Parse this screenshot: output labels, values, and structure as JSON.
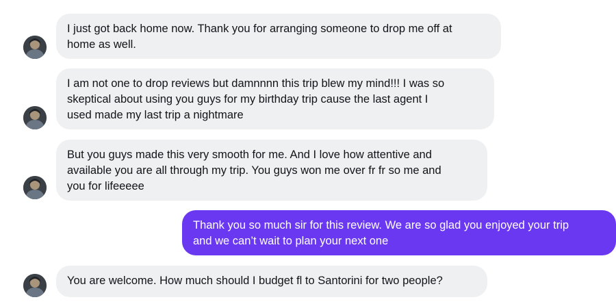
{
  "messages": [
    {
      "direction": "incoming",
      "lines": [
        "I just got back home now. Thank you for arranging someone to drop me off at",
        "home as well."
      ]
    },
    {
      "direction": "incoming",
      "lines": [
        "I am not one to drop reviews but damnnnn this trip blew my mind!!! I was so",
        "skeptical about using you guys for my birthday trip cause the last agent I",
        "used made my last trip a nightmare"
      ]
    },
    {
      "direction": "incoming",
      "lines": [
        "But you guys made this very smooth for me. And I love how attentive and",
        "available you are all through my trip. You guys won me over fr fr so me and",
        "you for lifeeeee"
      ]
    },
    {
      "direction": "outgoing",
      "lines": [
        "Thank you so much sir for this review. We are so glad you enjoyed your trip",
        "and we can’t wait to plan your next one"
      ]
    },
    {
      "direction": "incoming",
      "lines": [
        "You are welcome. How much should I budget fl to Santorini for two people?"
      ]
    }
  ],
  "colors": {
    "incoming_bubble": "#eef0f2",
    "outgoing_bubble": "#6a38f0",
    "incoming_text": "#111418",
    "outgoing_text": "#ffffff"
  },
  "icons": {
    "avatar": "contact-avatar-photo"
  }
}
